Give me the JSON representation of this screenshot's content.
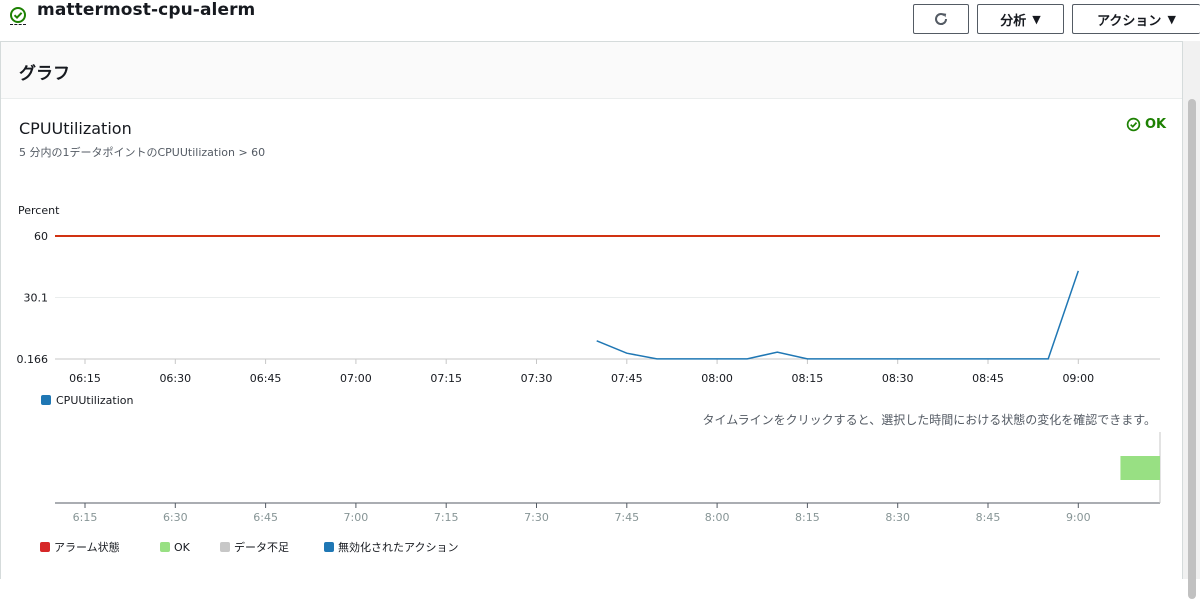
{
  "header": {
    "alarm_name": "mattermost-cpu-alerm",
    "refresh_icon": "refresh-icon",
    "analyze_label": "分析",
    "actions_label": "アクション"
  },
  "panel": {
    "title": "グラフ",
    "metric_title": "CPUUtilization",
    "metric_description": "5 分内の1データポイントのCPUUtilization > 60",
    "status_label": "OK",
    "timeline_hint": "タイムラインをクリックすると、選択した時間における状態の変化を確認できます。"
  },
  "colors": {
    "threshold": "#d13212",
    "series": "#1f77b4",
    "ok": "#1d8102",
    "ok_state": "#98e083",
    "alarm_state": "#d62728",
    "insufficient_data": "#c7c7c7",
    "disabled_actions": "#1f77b4"
  },
  "chart_data": {
    "type": "line",
    "ylabel": "Percent",
    "y_ticks": [
      {
        "value": 60,
        "label": "60"
      },
      {
        "value": 30.1,
        "label": "30.1"
      },
      {
        "value": 0.166,
        "label": "0.166"
      }
    ],
    "ylim": [
      0.166,
      60
    ],
    "x_ticks": [
      "06:15",
      "06:30",
      "06:45",
      "07:00",
      "07:15",
      "07:30",
      "07:45",
      "08:00",
      "08:15",
      "08:30",
      "08:45",
      "09:00"
    ],
    "threshold": 60,
    "series": [
      {
        "name": "CPUUtilization",
        "points": [
          {
            "x": "07:40",
            "y": 9
          },
          {
            "x": "07:45",
            "y": 3
          },
          {
            "x": "07:50",
            "y": 0.2
          },
          {
            "x": "07:55",
            "y": 0.2
          },
          {
            "x": "08:00",
            "y": 0.2
          },
          {
            "x": "08:05",
            "y": 0.2
          },
          {
            "x": "08:10",
            "y": 3.5
          },
          {
            "x": "08:15",
            "y": 0.2
          },
          {
            "x": "08:20",
            "y": 0.2
          },
          {
            "x": "08:25",
            "y": 0.2
          },
          {
            "x": "08:30",
            "y": 0.2
          },
          {
            "x": "08:35",
            "y": 0.2
          },
          {
            "x": "08:40",
            "y": 0.2
          },
          {
            "x": "08:45",
            "y": 0.2
          },
          {
            "x": "08:50",
            "y": 0.2
          },
          {
            "x": "08:55",
            "y": 0.2
          },
          {
            "x": "09:00",
            "y": 43
          }
        ]
      }
    ],
    "timeline": {
      "x_ticks": [
        "6:15",
        "6:30",
        "6:45",
        "7:00",
        "7:15",
        "7:30",
        "7:45",
        "8:00",
        "8:15",
        "8:30",
        "8:45",
        "9:00"
      ],
      "ok_segment": {
        "start": "09:07",
        "state": "OK"
      }
    },
    "timeline_legend": [
      {
        "label": "アラーム状態",
        "color": "#d62728"
      },
      {
        "label": "OK",
        "color": "#98e083"
      },
      {
        "label": "データ不足",
        "color": "#c7c7c7"
      },
      {
        "label": "無効化されたアクション",
        "color": "#1f77b4"
      }
    ]
  }
}
